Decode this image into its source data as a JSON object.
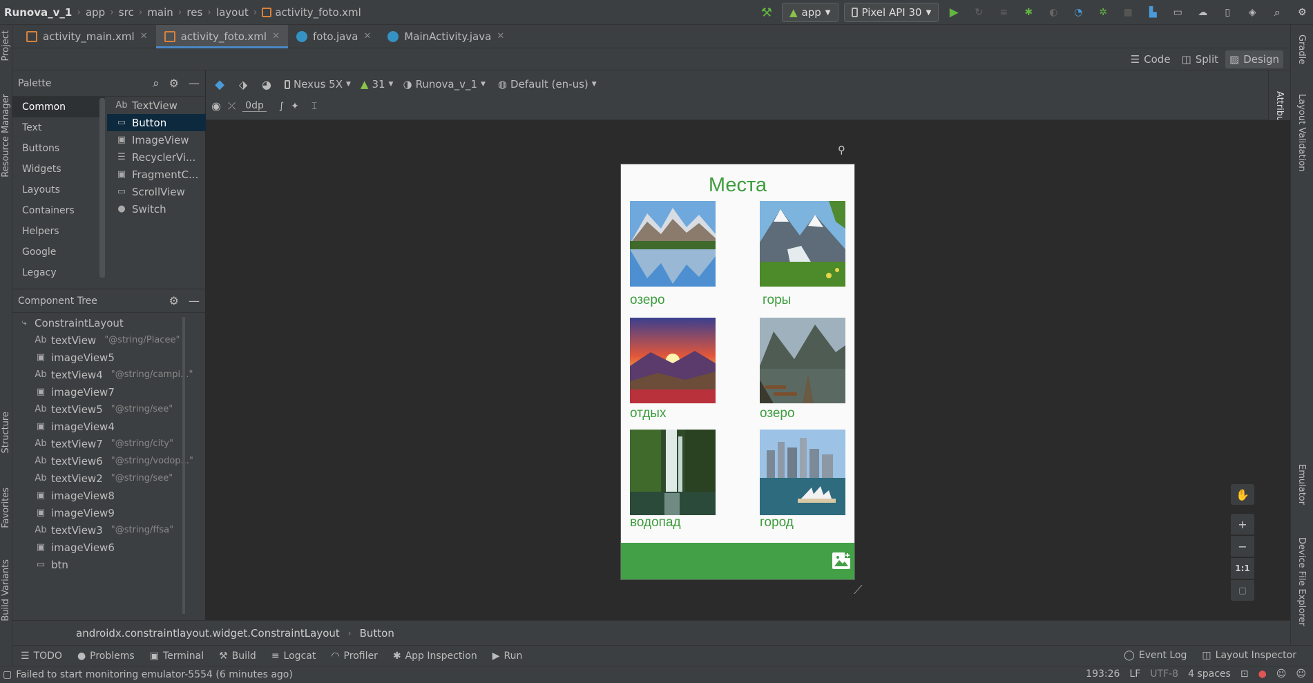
{
  "navbar": {
    "breadcrumbs": [
      "Runova_v_1",
      "app",
      "src",
      "main",
      "res",
      "layout",
      "activity_foto.xml"
    ],
    "run_config": "app",
    "device": "Pixel API 30"
  },
  "tabs": [
    {
      "label": "activity_main.xml"
    },
    {
      "label": "activity_foto.xml"
    },
    {
      "label": "foto.java"
    },
    {
      "label": "MainActivity.java"
    }
  ],
  "mode": {
    "code": "Code",
    "split": "Split",
    "design": "Design"
  },
  "left_strip": {
    "project": "Project",
    "resource_manager": "Resource Manager",
    "structure": "Structure",
    "favorites": "Favorites",
    "build_variants": "Build Variants"
  },
  "right_strip": {
    "gradle": "Gradle",
    "layout_validation": "Layout Validation",
    "emulator": "Emulator",
    "device_file_explorer": "Device File Explorer",
    "attributes": "Attributes"
  },
  "palette": {
    "title": "Palette",
    "categories": [
      "Common",
      "Text",
      "Buttons",
      "Widgets",
      "Layouts",
      "Containers",
      "Helpers",
      "Google",
      "Legacy"
    ],
    "items": [
      {
        "icon": "Ab",
        "label": "TextView"
      },
      {
        "icon": "▭",
        "label": "Button"
      },
      {
        "icon": "▣",
        "label": "ImageView"
      },
      {
        "icon": "☰",
        "label": "RecyclerVi..."
      },
      {
        "icon": "▣",
        "label": "FragmentC..."
      },
      {
        "icon": "▭",
        "label": "ScrollView"
      },
      {
        "icon": "●",
        "label": "Switch"
      }
    ]
  },
  "tree": {
    "title": "Component Tree",
    "root": "ConstraintLayout",
    "rows": [
      {
        "icon": "Ab",
        "name": "textView",
        "ref": "\"@string/Placee\""
      },
      {
        "icon": "▣",
        "name": "imageView5",
        "ref": ""
      },
      {
        "icon": "Ab",
        "name": "textView4",
        "ref": "\"@string/campi...\""
      },
      {
        "icon": "▣",
        "name": "imageView7",
        "ref": ""
      },
      {
        "icon": "Ab",
        "name": "textView5",
        "ref": "\"@string/see\""
      },
      {
        "icon": "▣",
        "name": "imageView4",
        "ref": ""
      },
      {
        "icon": "Ab",
        "name": "textView7",
        "ref": "\"@string/city\""
      },
      {
        "icon": "Ab",
        "name": "textView6",
        "ref": "\"@string/vodop...\""
      },
      {
        "icon": "Ab",
        "name": "textView2",
        "ref": "\"@string/see\""
      },
      {
        "icon": "▣",
        "name": "imageView8",
        "ref": ""
      },
      {
        "icon": "▣",
        "name": "imageView9",
        "ref": ""
      },
      {
        "icon": "Ab",
        "name": "textView3",
        "ref": "\"@string/ffsa\""
      },
      {
        "icon": "▣",
        "name": "imageView6",
        "ref": ""
      },
      {
        "icon": "▭",
        "name": "btn",
        "ref": ""
      }
    ]
  },
  "design_toolbar": {
    "device": "Nexus 5X",
    "api": "31",
    "theme": "Runova_v_1",
    "locale": "Default (en-us)",
    "margin": "0dp"
  },
  "phone": {
    "title": "Места",
    "places": [
      {
        "label": "озеро",
        "scene": "mountain-lake"
      },
      {
        "label": "горы",
        "scene": "mountains"
      },
      {
        "label": "отдых",
        "scene": "sunset"
      },
      {
        "label": "озеро",
        "scene": "lake-boats"
      },
      {
        "label": "водопад",
        "scene": "waterfall"
      },
      {
        "label": "город",
        "scene": "city"
      }
    ],
    "colors": {
      "accent": "#3d9c3d",
      "bar": "#43a047"
    }
  },
  "zoom": {
    "one_to_one": "1:1"
  },
  "breadcrumb_bar": {
    "path": "androidx.constraintlayout.widget.ConstraintLayout",
    "current": "Button"
  },
  "tool_windows": [
    "TODO",
    "Problems",
    "Terminal",
    "Build",
    "Logcat",
    "Profiler",
    "App Inspection",
    "Run"
  ],
  "tool_windows_right": [
    "Event Log",
    "Layout Inspector"
  ],
  "status": {
    "message": "Failed to start monitoring emulator-5554 (6 minutes ago)",
    "position": "193:26",
    "line_sep": "LF",
    "encoding": "UTF-8",
    "indent": "4 spaces"
  }
}
